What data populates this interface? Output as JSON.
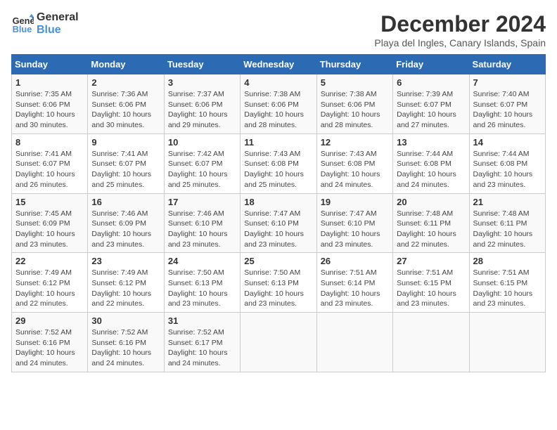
{
  "logo": {
    "line1": "General",
    "line2": "Blue"
  },
  "title": "December 2024",
  "subtitle": "Playa del Ingles, Canary Islands, Spain",
  "weekdays": [
    "Sunday",
    "Monday",
    "Tuesday",
    "Wednesday",
    "Thursday",
    "Friday",
    "Saturday"
  ],
  "weeks": [
    [
      {
        "day": "1",
        "info": "Sunrise: 7:35 AM\nSunset: 6:06 PM\nDaylight: 10 hours\nand 30 minutes."
      },
      {
        "day": "2",
        "info": "Sunrise: 7:36 AM\nSunset: 6:06 PM\nDaylight: 10 hours\nand 30 minutes."
      },
      {
        "day": "3",
        "info": "Sunrise: 7:37 AM\nSunset: 6:06 PM\nDaylight: 10 hours\nand 29 minutes."
      },
      {
        "day": "4",
        "info": "Sunrise: 7:38 AM\nSunset: 6:06 PM\nDaylight: 10 hours\nand 28 minutes."
      },
      {
        "day": "5",
        "info": "Sunrise: 7:38 AM\nSunset: 6:06 PM\nDaylight: 10 hours\nand 28 minutes."
      },
      {
        "day": "6",
        "info": "Sunrise: 7:39 AM\nSunset: 6:07 PM\nDaylight: 10 hours\nand 27 minutes."
      },
      {
        "day": "7",
        "info": "Sunrise: 7:40 AM\nSunset: 6:07 PM\nDaylight: 10 hours\nand 26 minutes."
      }
    ],
    [
      {
        "day": "8",
        "info": "Sunrise: 7:41 AM\nSunset: 6:07 PM\nDaylight: 10 hours\nand 26 minutes."
      },
      {
        "day": "9",
        "info": "Sunrise: 7:41 AM\nSunset: 6:07 PM\nDaylight: 10 hours\nand 25 minutes."
      },
      {
        "day": "10",
        "info": "Sunrise: 7:42 AM\nSunset: 6:07 PM\nDaylight: 10 hours\nand 25 minutes."
      },
      {
        "day": "11",
        "info": "Sunrise: 7:43 AM\nSunset: 6:08 PM\nDaylight: 10 hours\nand 25 minutes."
      },
      {
        "day": "12",
        "info": "Sunrise: 7:43 AM\nSunset: 6:08 PM\nDaylight: 10 hours\nand 24 minutes."
      },
      {
        "day": "13",
        "info": "Sunrise: 7:44 AM\nSunset: 6:08 PM\nDaylight: 10 hours\nand 24 minutes."
      },
      {
        "day": "14",
        "info": "Sunrise: 7:44 AM\nSunset: 6:08 PM\nDaylight: 10 hours\nand 23 minutes."
      }
    ],
    [
      {
        "day": "15",
        "info": "Sunrise: 7:45 AM\nSunset: 6:09 PM\nDaylight: 10 hours\nand 23 minutes."
      },
      {
        "day": "16",
        "info": "Sunrise: 7:46 AM\nSunset: 6:09 PM\nDaylight: 10 hours\nand 23 minutes."
      },
      {
        "day": "17",
        "info": "Sunrise: 7:46 AM\nSunset: 6:10 PM\nDaylight: 10 hours\nand 23 minutes."
      },
      {
        "day": "18",
        "info": "Sunrise: 7:47 AM\nSunset: 6:10 PM\nDaylight: 10 hours\nand 23 minutes."
      },
      {
        "day": "19",
        "info": "Sunrise: 7:47 AM\nSunset: 6:10 PM\nDaylight: 10 hours\nand 23 minutes."
      },
      {
        "day": "20",
        "info": "Sunrise: 7:48 AM\nSunset: 6:11 PM\nDaylight: 10 hours\nand 22 minutes."
      },
      {
        "day": "21",
        "info": "Sunrise: 7:48 AM\nSunset: 6:11 PM\nDaylight: 10 hours\nand 22 minutes."
      }
    ],
    [
      {
        "day": "22",
        "info": "Sunrise: 7:49 AM\nSunset: 6:12 PM\nDaylight: 10 hours\nand 22 minutes."
      },
      {
        "day": "23",
        "info": "Sunrise: 7:49 AM\nSunset: 6:12 PM\nDaylight: 10 hours\nand 22 minutes."
      },
      {
        "day": "24",
        "info": "Sunrise: 7:50 AM\nSunset: 6:13 PM\nDaylight: 10 hours\nand 23 minutes."
      },
      {
        "day": "25",
        "info": "Sunrise: 7:50 AM\nSunset: 6:13 PM\nDaylight: 10 hours\nand 23 minutes."
      },
      {
        "day": "26",
        "info": "Sunrise: 7:51 AM\nSunset: 6:14 PM\nDaylight: 10 hours\nand 23 minutes."
      },
      {
        "day": "27",
        "info": "Sunrise: 7:51 AM\nSunset: 6:15 PM\nDaylight: 10 hours\nand 23 minutes."
      },
      {
        "day": "28",
        "info": "Sunrise: 7:51 AM\nSunset: 6:15 PM\nDaylight: 10 hours\nand 23 minutes."
      }
    ],
    [
      {
        "day": "29",
        "info": "Sunrise: 7:52 AM\nSunset: 6:16 PM\nDaylight: 10 hours\nand 24 minutes."
      },
      {
        "day": "30",
        "info": "Sunrise: 7:52 AM\nSunset: 6:16 PM\nDaylight: 10 hours\nand 24 minutes."
      },
      {
        "day": "31",
        "info": "Sunrise: 7:52 AM\nSunset: 6:17 PM\nDaylight: 10 hours\nand 24 minutes."
      },
      null,
      null,
      null,
      null
    ]
  ]
}
